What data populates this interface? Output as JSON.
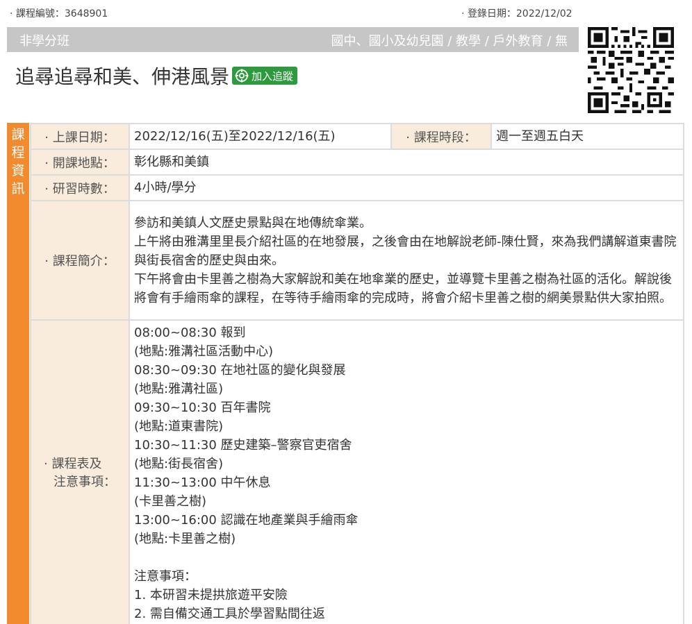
{
  "meta": {
    "course_no": "· 課程編號：3648901",
    "reg_date": "· 登錄日期：2022/12/02"
  },
  "category": {
    "left": "非學分班",
    "right": "國中、國小及幼兒園 / 教學 / 戶外教育 / 無"
  },
  "title": "追尋追尋和美、伸港風景",
  "follow_button": "加入追蹤",
  "side_label": [
    "課",
    "程",
    "資",
    "訊"
  ],
  "rows": {
    "date_label": "· 上課日期：",
    "date_value": "2022/12/16(五)至2022/12/16(五)",
    "period_label": "· 課程時段：",
    "period_value": "週一至週五白天",
    "location_label": "· 開課地點：",
    "location_value": "彰化縣和美鎮",
    "hours_label": "· 研習時數：",
    "hours_value": "4小時/學分",
    "intro_label": "· 課程簡介：",
    "intro_lines": [
      "參訪和美鎮人文歷史景點與在地傳統傘業。",
      "上午將由雅溝里里長介紹社區的在地發展，之後會由在地解說老師-陳仕賢，來為我們講解道東書院與街長宿舍的歷史與由來。",
      "下午將會由卡里善之樹為大家解說和美在地傘業的歷史，並導覽卡里善之樹為社區的活化。解說後將會有手繪雨傘的課程，在等待手繪雨傘的完成時，將會介紹卡里善之樹的網美景點供大家拍照。"
    ],
    "schedule_label_1": "· 課程表及",
    "schedule_label_2": "注意事項：",
    "schedule_lines": [
      "08:00~08:30 報到",
      "(地點:雅溝社區活動中心)",
      "08:30~09:30 在地社區的變化與發展",
      "(地點:雅溝社區)",
      "09:30~10:30 百年書院",
      "(地點:道東書院)",
      "10:30~11:30 歷史建築–警察官吏宿舍",
      "(地點:街長宿舍)",
      "11:30~13:00 中午休息",
      "(卡里善之樹)",
      "13:00~16:00 認識在地產業與手繪雨傘",
      "(地點:卡里善之樹)"
    ],
    "notes_title": "注意事項：",
    "notes": [
      "1. 本研習未提拱旅遊平安險",
      "2. 需自備交通工具於學習點間往返"
    ]
  },
  "colors": {
    "accent_orange": "#f28a2e",
    "label_bg": "#f9ecdc",
    "category_bg": "#c6c6c6",
    "follow_green": "#2e9a3e"
  },
  "icons": {
    "follow": "target-icon",
    "qr": "qr-code-icon"
  }
}
